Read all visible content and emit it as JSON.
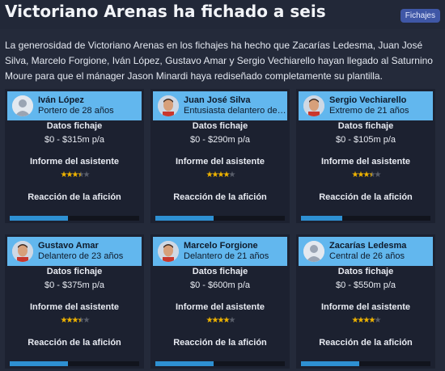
{
  "header": {
    "title": "Victoriano Arenas ha fichado a seis",
    "tag": "Fichajes"
  },
  "intro": "La generosidad de Victoriano Arenas en los fichajes ha hecho que Zacarías Ledesma, Juan José Silva, Marcelo Forgione, Iván López, Gustavo Amar y Sergio Vechiarello hayan llegado al Saturnino Moure para que el mánager Jason Minardi haya rediseñado completamente su plantilla.",
  "labels": {
    "datos": "Datos fichaje",
    "informe": "Informe del asistente",
    "reaccion": "Reacción de la afición"
  },
  "colors": {
    "card_header": "#62b7ee",
    "star_filled": "#f0b400",
    "star_empty": "#5a5f6b",
    "bar_fill": "#2e90d2"
  },
  "players": [
    {
      "name": "Iván López",
      "role": "Portero de 28 años",
      "fee": "$0 - $315m p/a",
      "rating": 3.5,
      "reaction": 0.45,
      "avatar": "silhouette-icon"
    },
    {
      "name": "Juan José Silva",
      "role": "Entusiasta delantero de…",
      "fee": "$0 - $290m p/a",
      "rating": 4,
      "reaction": 0.45,
      "avatar": "player-face-icon"
    },
    {
      "name": "Sergio Vechiarello",
      "role": "Extremo de 21 años",
      "fee": "$0 - $105m p/a",
      "rating": 3.5,
      "reaction": 0.32,
      "avatar": "player-face-icon"
    },
    {
      "name": "Gustavo Amar",
      "role": "Delantero de 23 años",
      "fee": "$0 - $375m p/a",
      "rating": 3.5,
      "reaction": 0.45,
      "avatar": "player-face-icon"
    },
    {
      "name": "Marcelo Forgione",
      "role": "Delantero de 21 años",
      "fee": "$0 - $600m p/a",
      "rating": 4,
      "reaction": 0.45,
      "avatar": "player-face-icon"
    },
    {
      "name": "Zacarías Ledesma",
      "role": "Central de 26 años",
      "fee": "$0 - $550m p/a",
      "rating": 4,
      "reaction": 0.45,
      "avatar": "silhouette-icon"
    }
  ]
}
